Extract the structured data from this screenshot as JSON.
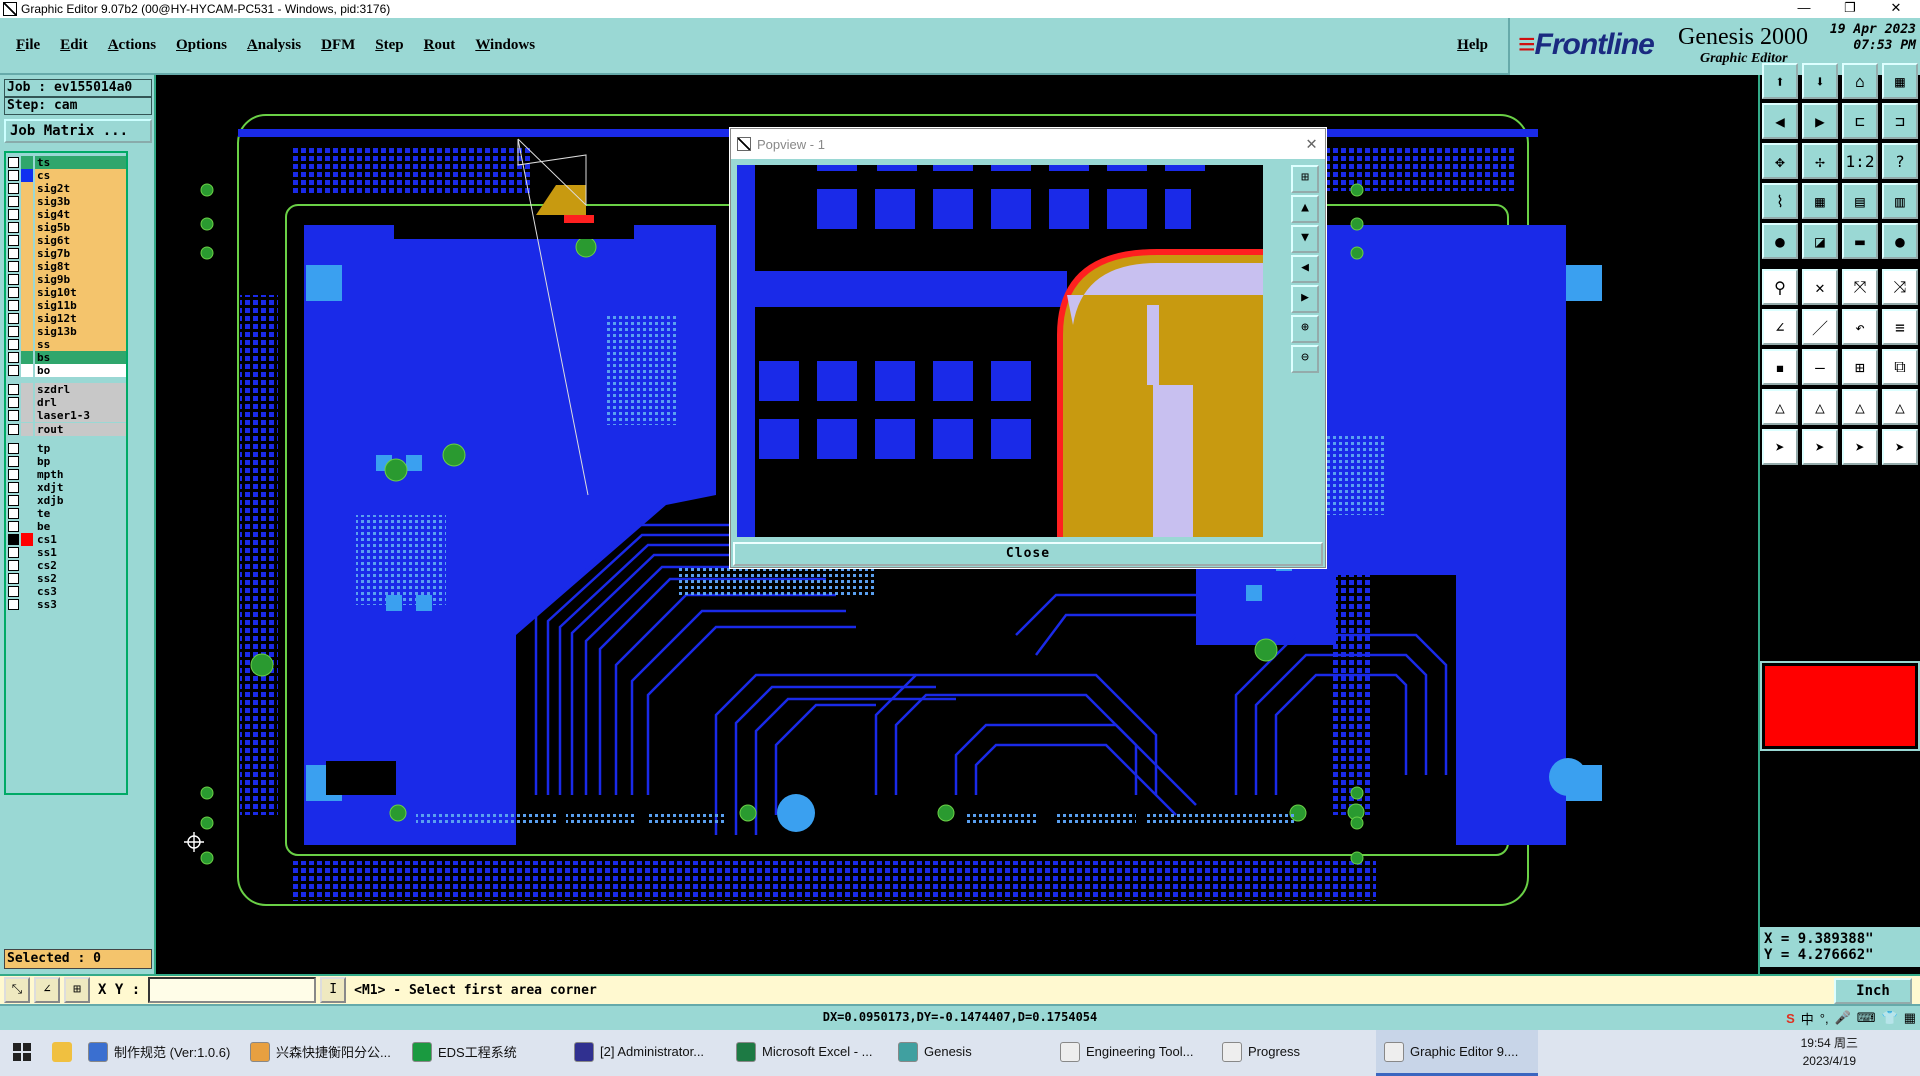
{
  "window": {
    "title": "Graphic Editor 9.07b2 (00@HY-HYCAM-PC531 - Windows, pid:3176)"
  },
  "menu": {
    "items": [
      "File",
      "Edit",
      "Actions",
      "Options",
      "Analysis",
      "DFM",
      "Step",
      "Rout",
      "Windows"
    ],
    "help": "Help"
  },
  "brand": {
    "logo": "Frontline",
    "product": "Genesis 2000",
    "subtitle": "Graphic Editor",
    "date": "19 Apr 2023",
    "time": "07:53 PM"
  },
  "job": {
    "job": "Job : ev155014a0",
    "step": "Step: cam",
    "matrix_button": "Job Matrix ..."
  },
  "layers": [
    {
      "name": "ts",
      "color": "#2fa66c",
      "swatch": "#2fa66c"
    },
    {
      "name": "cs",
      "color": "#f4c46c",
      "swatch": "#1030f0"
    },
    {
      "name": "sig2t",
      "color": "#f4c46c",
      "swatch": ""
    },
    {
      "name": "sig3b",
      "color": "#f4c46c",
      "swatch": ""
    },
    {
      "name": "sig4t",
      "color": "#f4c46c",
      "swatch": ""
    },
    {
      "name": "sig5b",
      "color": "#f4c46c",
      "swatch": ""
    },
    {
      "name": "sig6t",
      "color": "#f4c46c",
      "swatch": ""
    },
    {
      "name": "sig7b",
      "color": "#f4c46c",
      "swatch": ""
    },
    {
      "name": "sig8t",
      "color": "#f4c46c",
      "swatch": ""
    },
    {
      "name": "sig9b",
      "color": "#f4c46c",
      "swatch": ""
    },
    {
      "name": "sig10t",
      "color": "#f4c46c",
      "swatch": ""
    },
    {
      "name": "sig11b",
      "color": "#f4c46c",
      "swatch": ""
    },
    {
      "name": "sig12t",
      "color": "#f4c46c",
      "swatch": ""
    },
    {
      "name": "sig13b",
      "color": "#f4c46c",
      "swatch": ""
    },
    {
      "name": "ss",
      "color": "#f4c46c",
      "swatch": ""
    },
    {
      "name": "bs",
      "color": "#2fa66c",
      "swatch": ""
    },
    {
      "name": "bo",
      "color": "#ffffff",
      "swatch": ""
    },
    {
      "name": "szdrl",
      "color": "#c8c8c8",
      "swatch": ""
    },
    {
      "name": "drl",
      "color": "#c8c8c8",
      "swatch": ""
    },
    {
      "name": "laser1-3",
      "color": "#c8c8c8",
      "swatch": ""
    },
    {
      "name": "rout",
      "color": "#c8c8c8",
      "swatch": ""
    },
    {
      "name": "tp",
      "color": "#9ad8d4",
      "swatch": ""
    },
    {
      "name": "bp",
      "color": "#9ad8d4",
      "swatch": ""
    },
    {
      "name": "mpth",
      "color": "#9ad8d4",
      "swatch": ""
    },
    {
      "name": "xdjt",
      "color": "#9ad8d4",
      "swatch": ""
    },
    {
      "name": "xdjb",
      "color": "#9ad8d4",
      "swatch": ""
    },
    {
      "name": "te",
      "color": "#9ad8d4",
      "swatch": ""
    },
    {
      "name": "be",
      "color": "#9ad8d4",
      "swatch": ""
    },
    {
      "name": "cs1",
      "color": "#9ad8d4",
      "swatch": "#ff0000"
    },
    {
      "name": "ss1",
      "color": "#9ad8d4",
      "swatch": ""
    },
    {
      "name": "cs2",
      "color": "#9ad8d4",
      "swatch": ""
    },
    {
      "name": "ss2",
      "color": "#9ad8d4",
      "swatch": ""
    },
    {
      "name": "cs3",
      "color": "#9ad8d4",
      "swatch": ""
    },
    {
      "name": "ss3",
      "color": "#9ad8d4",
      "swatch": ""
    }
  ],
  "selected": "Selected : 0",
  "popup": {
    "title": "Popview - 1",
    "close": "Close"
  },
  "coords": {
    "x": "X = 9.389388\"",
    "y": "Y = 4.276662\""
  },
  "command": {
    "xy_label": "X Y :",
    "input_value": "",
    "message": "<M1> - Select first area corner",
    "units": "Inch"
  },
  "status": "DX=0.0950173,DY=-0.1474407,D=0.1754054",
  "taskbar": [
    {
      "label": "制作规范 (Ver:1.0.6)",
      "icon": "#3a6fd0",
      "active": false
    },
    {
      "label": "兴森快捷衡阳分公...",
      "icon": "#e8a040",
      "active": false
    },
    {
      "label": "EDS工程系统",
      "icon": "#1a9a40",
      "active": false
    },
    {
      "label": "[2] Administrator...",
      "icon": "#303090",
      "active": false
    },
    {
      "label": "Microsoft Excel - ...",
      "icon": "#1d7a44",
      "active": false
    },
    {
      "label": "Genesis",
      "icon": "#40a0a0",
      "active": false
    },
    {
      "label": "Engineering Tool...",
      "icon": "#eeeeee",
      "active": false
    },
    {
      "label": "Progress",
      "icon": "#eeeeee",
      "active": false
    },
    {
      "label": "Graphic Editor 9....",
      "icon": "#eeeeee",
      "active": true
    }
  ],
  "tray": {
    "ime": "中",
    "time": "19:54 周三",
    "date": "2023/4/19"
  }
}
